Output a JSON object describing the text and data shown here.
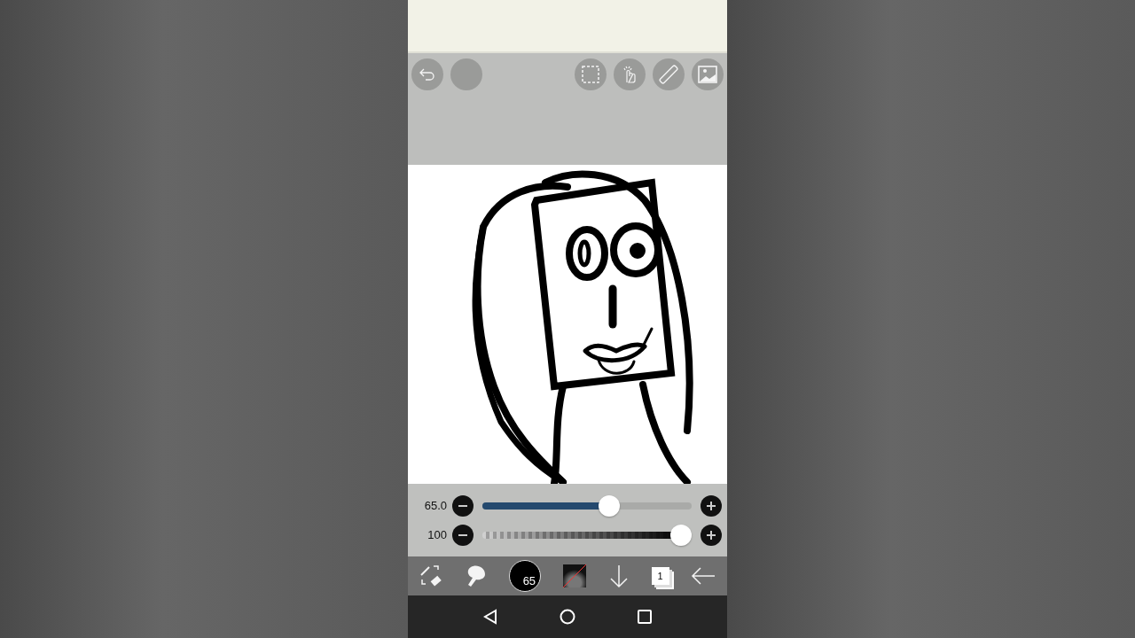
{
  "sliders": [
    {
      "kind": "size",
      "reading": "65.0",
      "level": 0.62
    },
    {
      "kind": "opacity",
      "reading": "100",
      "level": 1
    }
  ],
  "bottom_toolbar": {
    "brush_size": "65",
    "layer_count": "1"
  }
}
